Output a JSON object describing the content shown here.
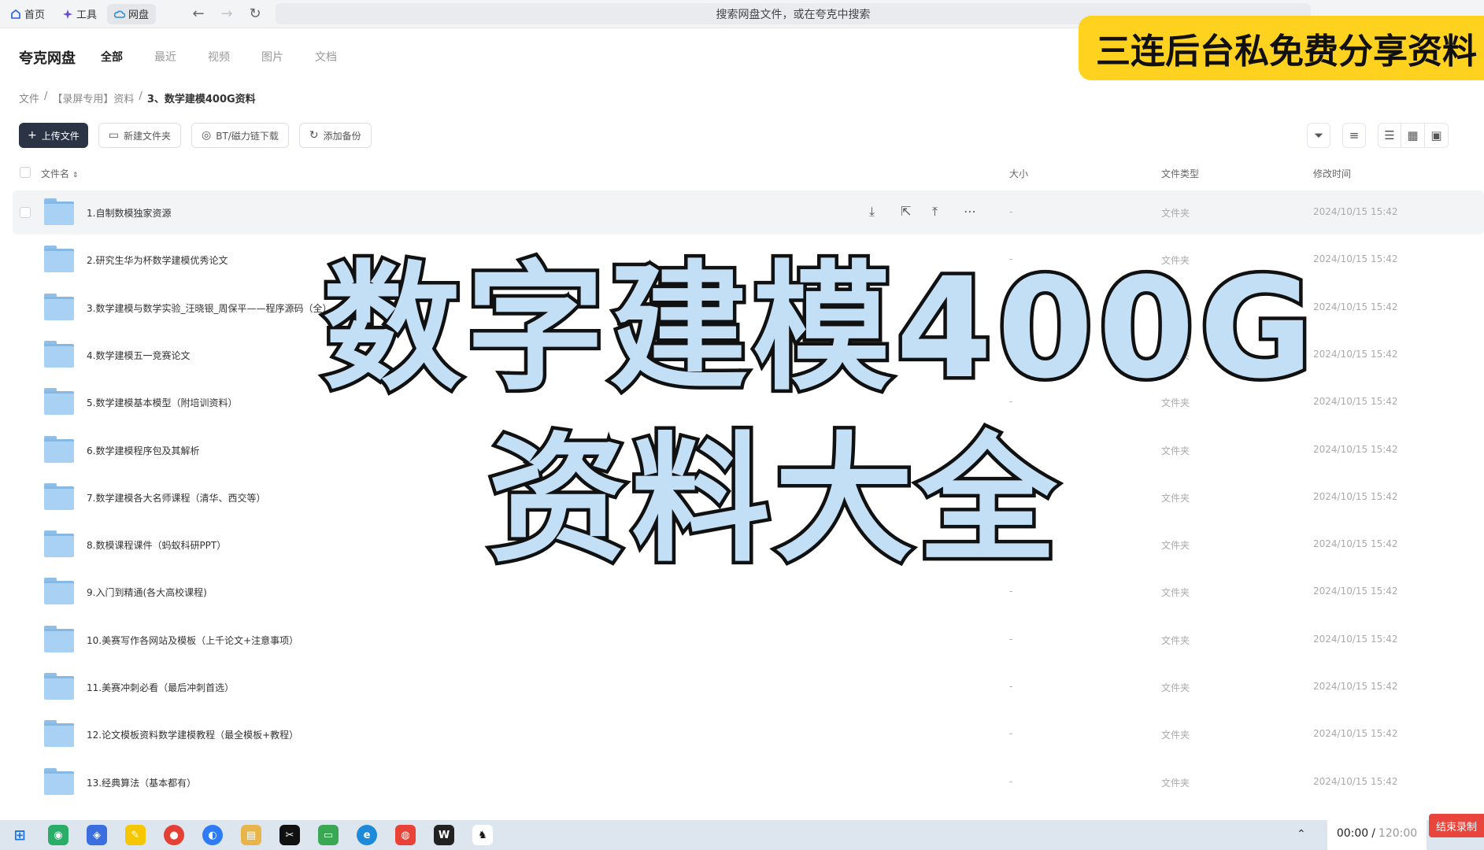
{
  "browser": {
    "tabs": [
      {
        "label": "首页",
        "icon": "home-icon"
      },
      {
        "label": "工具",
        "icon": "sparkle-icon"
      },
      {
        "label": "网盘",
        "icon": "cloud-icon"
      }
    ],
    "address_placeholder": "搜索网盘文件，或在夸克中搜索"
  },
  "app": {
    "title": "夸克网盘",
    "nav": [
      "全部",
      "最近",
      "视频",
      "图片",
      "文档"
    ]
  },
  "breadcrumb": {
    "items": [
      "文件",
      "【录屏专用】资料"
    ],
    "current": "3、数学建模400G资料"
  },
  "toolbar": {
    "upload": "上传文件",
    "new_folder": "新建文件夹",
    "bt_download": "BT/磁力链下载",
    "add_backup": "添加备份"
  },
  "table": {
    "headers": {
      "name": "文件名",
      "size": "大小",
      "type": "文件类型",
      "modified": "修改时间"
    },
    "rows": [
      {
        "name": "1.自制数模独家资源",
        "size": "-",
        "type": "文件夹",
        "modified": "2024/10/15 15:42"
      },
      {
        "name": "2.研究生华为杯数学建模优秀论文",
        "size": "-",
        "type": "文件夹",
        "modified": "2024/10/15 15:42"
      },
      {
        "name": "3.数学建模与数学实验_汪晓银_周保平——程序源码（全）",
        "size": "-",
        "type": "文件夹",
        "modified": "2024/10/15 15:42"
      },
      {
        "name": "4.数学建模五一竞赛论文",
        "size": "-",
        "type": "文件夹",
        "modified": "2024/10/15 15:42"
      },
      {
        "name": "5.数学建模基本模型（附培训资料）",
        "size": "-",
        "type": "文件夹",
        "modified": "2024/10/15 15:42"
      },
      {
        "name": "6.数学建模程序包及其解析",
        "size": "-",
        "type": "文件夹",
        "modified": "2024/10/15 15:42"
      },
      {
        "name": "7.数学建模各大名师课程（清华、西交等）",
        "size": "-",
        "type": "文件夹",
        "modified": "2024/10/15 15:42"
      },
      {
        "name": "8.数模课程课件（蚂蚁科研PPT）",
        "size": "-",
        "type": "文件夹",
        "modified": "2024/10/15 15:42"
      },
      {
        "name": "9.入门到精通(各大高校课程)",
        "size": "-",
        "type": "文件夹",
        "modified": "2024/10/15 15:42"
      },
      {
        "name": "10.美赛写作各网站及模板（上千论文+注意事项）",
        "size": "-",
        "type": "文件夹",
        "modified": "2024/10/15 15:42"
      },
      {
        "name": "11.美赛冲刺必看（最后冲刺首选）",
        "size": "-",
        "type": "文件夹",
        "modified": "2024/10/15 15:42"
      },
      {
        "name": "12.论文模板资料数学建模教程（最全模板+教程）",
        "size": "-",
        "type": "文件夹",
        "modified": "2024/10/15 15:42"
      },
      {
        "name": "13.经典算法（基本都有）",
        "size": "-",
        "type": "文件夹",
        "modified": "2024/10/15 15:42"
      }
    ]
  },
  "overlay": {
    "line1": "数字建模400G",
    "line2": "资料大全",
    "banner": "三连后台私免费分享资料"
  },
  "recorder": {
    "elapsed": "00:00",
    "total": "120:00",
    "stop": "结束录制"
  },
  "colors": {
    "primary_button": "#2b3445",
    "folder": "#a9d1f3",
    "banner": "#ffd21f",
    "overlay_text": "#c3dff5",
    "stop_button": "#e8453c"
  }
}
